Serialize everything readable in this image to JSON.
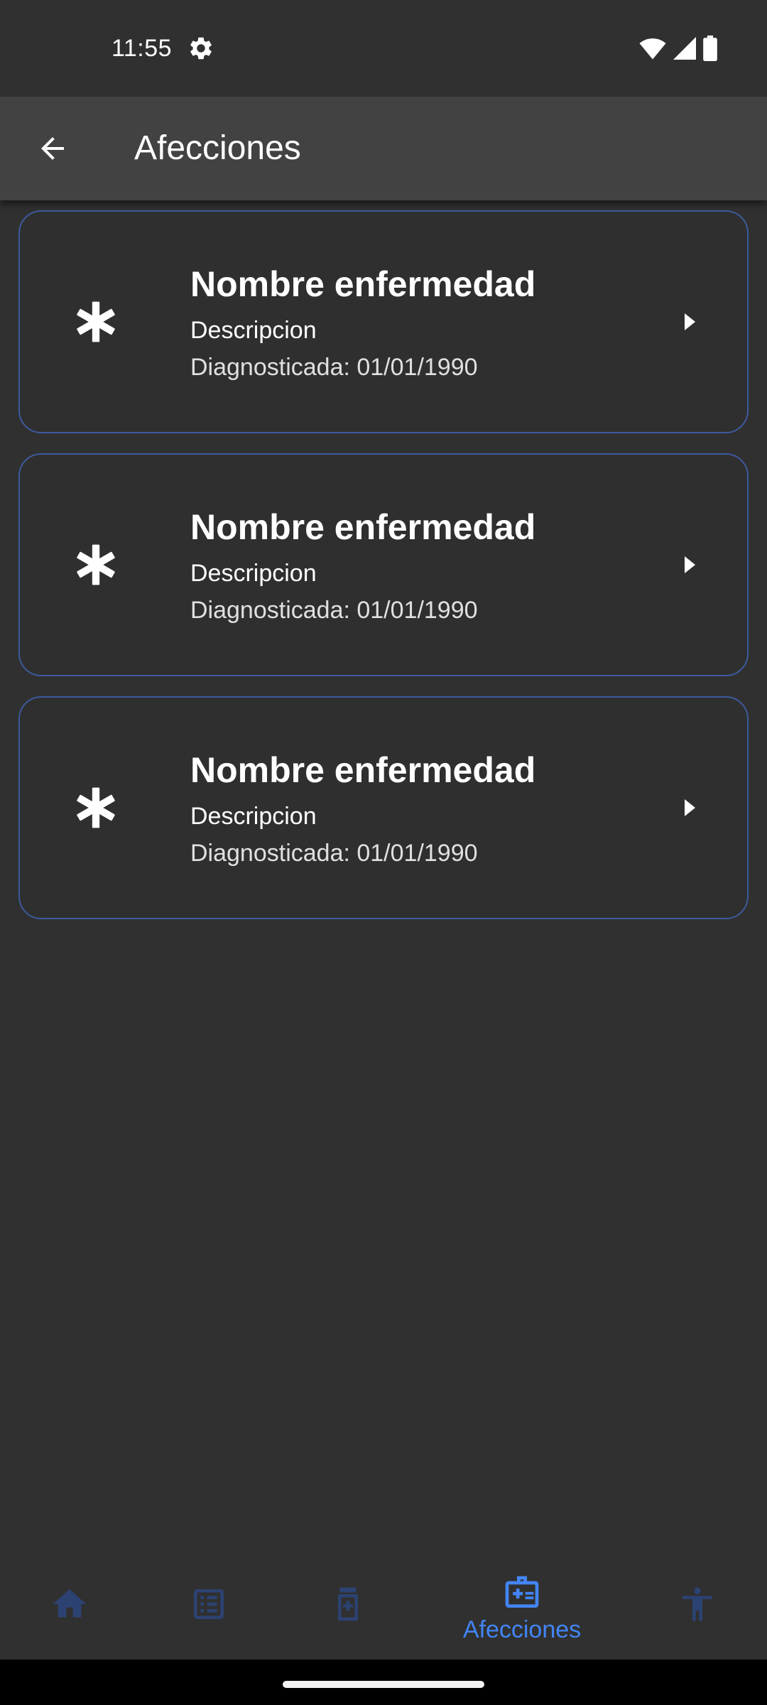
{
  "status_bar": {
    "time": "11:55",
    "icons": [
      "settings-gear-icon",
      "wifi-icon",
      "signal-icon",
      "battery-icon"
    ]
  },
  "app_bar": {
    "title": "Afecciones",
    "back_icon": "arrow-back-icon"
  },
  "conditions": [
    {
      "title": "Nombre enfermedad",
      "description": "Descripcion",
      "diagnosed": "Diagnosticada: 01/01/1990",
      "icon": "asterisk-icon"
    },
    {
      "title": "Nombre enfermedad",
      "description": "Descripcion",
      "diagnosed": "Diagnosticada: 01/01/1990",
      "icon": "asterisk-icon"
    },
    {
      "title": "Nombre enfermedad",
      "description": "Descripcion",
      "diagnosed": "Diagnosticada: 01/01/1990",
      "icon": "asterisk-icon"
    }
  ],
  "bottom_nav": {
    "items": [
      {
        "icon": "home-icon",
        "active": false
      },
      {
        "icon": "list-icon",
        "active": false
      },
      {
        "icon": "medicine-bottle-icon",
        "active": false
      },
      {
        "icon": "medical-kit-icon",
        "label": "Afecciones",
        "active": true
      },
      {
        "icon": "accessibility-icon",
        "active": false
      }
    ]
  },
  "colors": {
    "background": "#303030",
    "app_bar": "#424242",
    "card_border": "#3d5a9e",
    "nav_inactive": "#2c4272",
    "nav_active": "#4285f4"
  }
}
